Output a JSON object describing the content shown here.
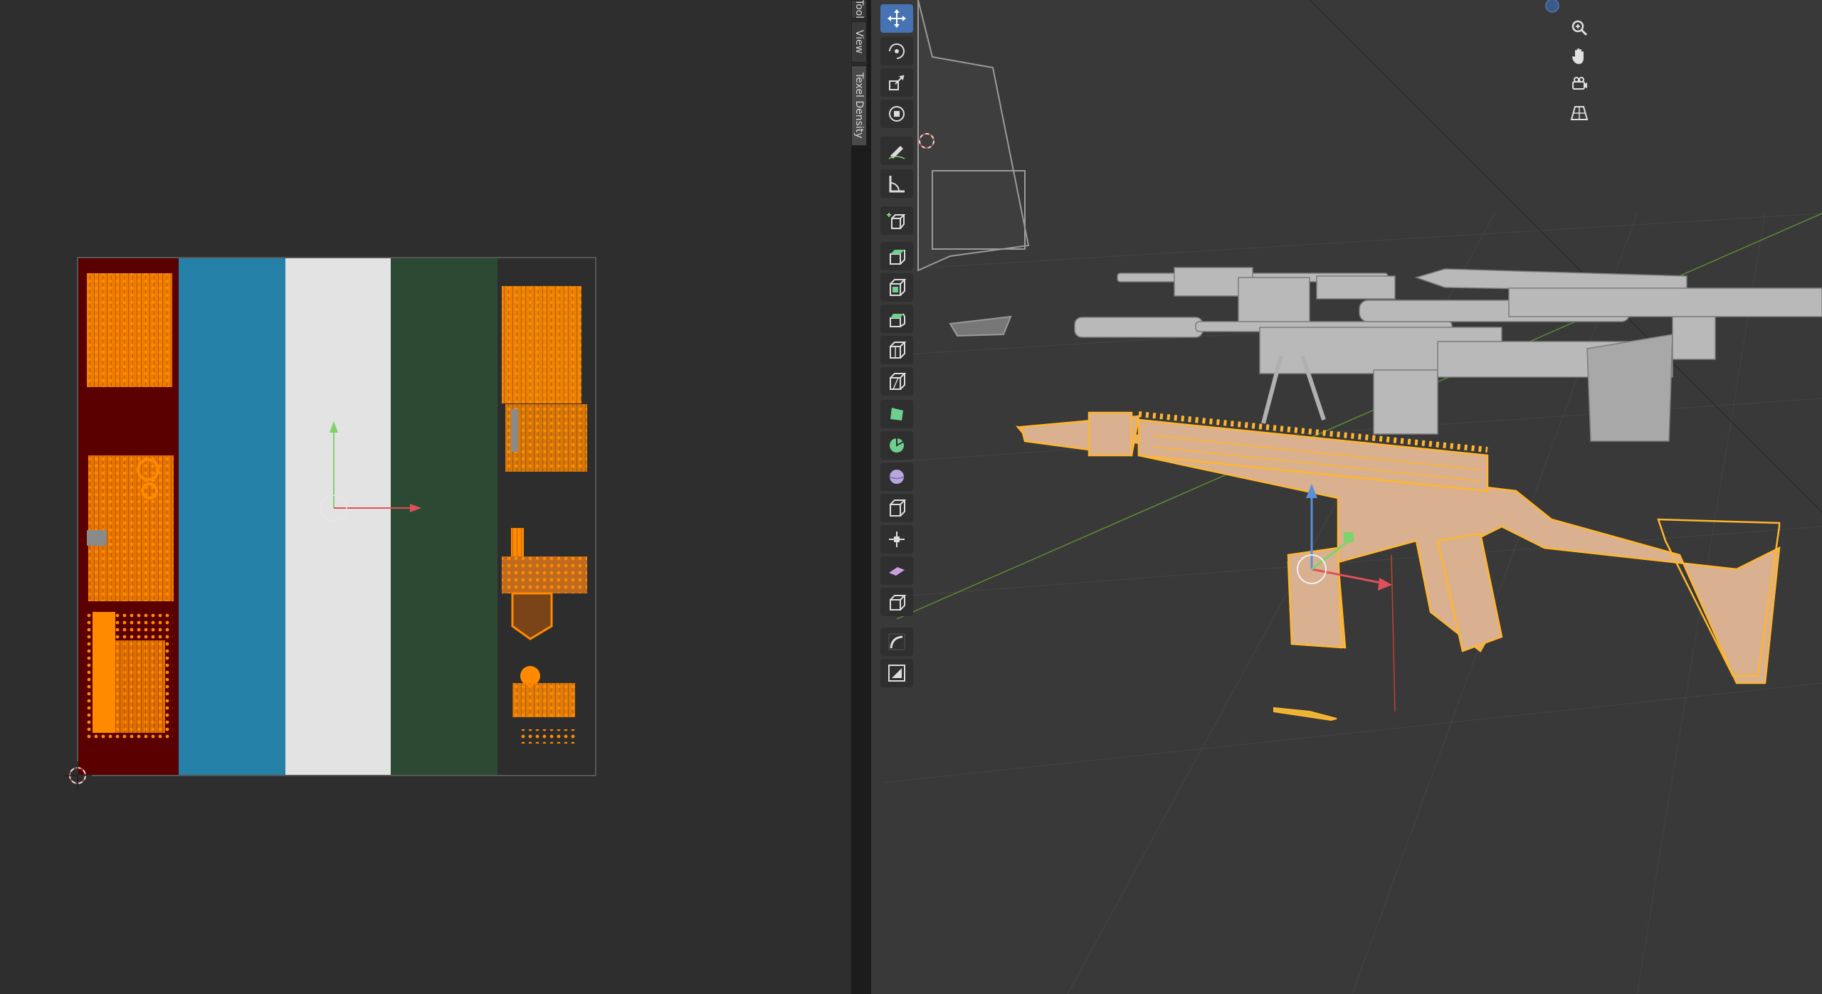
{
  "uv_editor": {
    "image_stripe_colors": [
      "#5a0000",
      "#2480a6",
      "#e3e3e3",
      "#2c4a33",
      "#2d2d2d"
    ],
    "uv_island_color": "#ff8a00",
    "gizmo_colors": {
      "x_axis": "#e0505a",
      "y_axis": "#7fd36b"
    }
  },
  "sidebar": {
    "tabs": [
      {
        "label": "Tool",
        "active": false
      },
      {
        "label": "View",
        "active": false
      },
      {
        "label": "Texel Density",
        "active": true
      }
    ]
  },
  "toolbar": {
    "tools": [
      {
        "icon": "move-icon",
        "active": true
      },
      {
        "icon": "rotate-icon",
        "active": false
      },
      {
        "icon": "scale-icon",
        "active": false
      },
      {
        "icon": "transform-icon",
        "active": false
      },
      {
        "icon": "annotate-icon",
        "active": false
      },
      {
        "icon": "measure-icon",
        "active": false
      },
      {
        "icon": "add-cube-icon",
        "active": false
      },
      {
        "icon": "extrude-region-icon",
        "active": false
      },
      {
        "icon": "inset-faces-icon",
        "active": false
      },
      {
        "icon": "bevel-icon",
        "active": false
      },
      {
        "icon": "loop-cut-icon",
        "active": false
      },
      {
        "icon": "knife-icon",
        "active": false
      },
      {
        "icon": "poly-build-icon",
        "active": false
      },
      {
        "icon": "spin-icon",
        "active": false
      },
      {
        "icon": "smooth-icon",
        "active": false
      },
      {
        "icon": "edge-slide-icon",
        "active": false
      },
      {
        "icon": "shrink-fatten-icon",
        "active": false
      },
      {
        "icon": "shear-icon",
        "active": false
      },
      {
        "icon": "rip-region-icon",
        "active": false
      },
      {
        "icon": "curve-draw-icon",
        "active": false
      },
      {
        "icon": "uv-select-icon",
        "active": false
      }
    ]
  },
  "viewport": {
    "navigation": [
      {
        "icon": "zoom-icon"
      },
      {
        "icon": "pan-hand-icon"
      },
      {
        "icon": "camera-view-icon"
      },
      {
        "icon": "perspective-grid-icon"
      }
    ],
    "selected_object_color": "#d9b090",
    "selection_outline_color": "#ffb62e",
    "object_color": "#b9b9b9"
  }
}
